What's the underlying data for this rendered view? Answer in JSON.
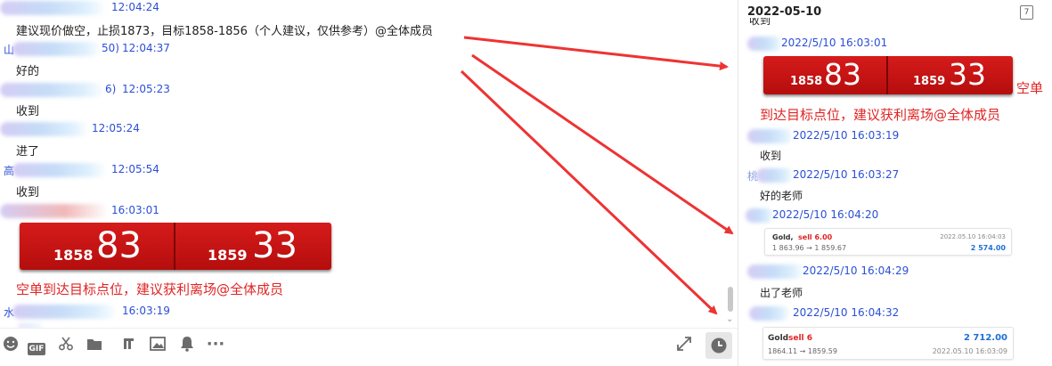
{
  "left_chat": {
    "messages": [
      {
        "time": "12:04:24",
        "text": "建议现价做空，止损1873，目标1858-1856（个人建议，仅供参考）@全体成员"
      },
      {
        "name_prefix": "山",
        "name_suffix": "50)",
        "time": "12:04:37",
        "text": "好的"
      },
      {
        "name_suffix": "6)",
        "time": "12:05:23",
        "text": "收到"
      },
      {
        "time": "12:05:24",
        "text": "进了"
      },
      {
        "name_prefix": "高",
        "time": "12:05:54",
        "text": "收到"
      },
      {
        "time": "16:03:01"
      },
      {
        "name_prefix": "水",
        "time": "16:03:19"
      }
    ],
    "quote": {
      "left_small": "1858",
      "left_big": "83",
      "right_small": "1859",
      "right_big": "33"
    },
    "caption": "空单到达目标点位，建议获利离场@全体成员"
  },
  "toolbar": {
    "emoji_icon": "smiley-icon",
    "gif_label": "GIF",
    "scissors_icon": "scissors-icon",
    "folder_icon": "folder-icon",
    "music_icon": "music-icon",
    "image_icon": "image-icon",
    "bell_icon": "bell-icon",
    "more_label": "···",
    "expand_icon": "expand-icon",
    "history_icon": "clock-icon"
  },
  "right_panel": {
    "date": "2022-05-10",
    "calendar_label": "7",
    "top_cut_text": "收到",
    "messages": [
      {
        "time": "2022/5/10 16:03:01"
      },
      {
        "time": "2022/5/10 16:03:19",
        "text": "收到"
      },
      {
        "name_prefix": "桃",
        "time": "2022/5/10 16:03:27",
        "text": "好的老师"
      },
      {
        "time": "2022/5/10 16:04:20"
      },
      {
        "time": "2022/5/10 16:04:29",
        "text": "出了老师"
      },
      {
        "time": "2022/5/10 16:04:32"
      }
    ],
    "quote": {
      "left_small": "1858",
      "left_big": "83",
      "right_small": "1859",
      "right_big": "33",
      "side_label": "空单"
    },
    "caption": "到达目标点位，建议获利离场@全体成员",
    "trade_card_1": {
      "symbol": "Gold,",
      "action": "sell 6.00",
      "date": "2022.05.10 16:04:03",
      "prices": "1 863.96 → 1 859.67",
      "profit": "2 574.00"
    },
    "trade_card_2": {
      "symbol": "Gold",
      "action": "sell 6",
      "profit": "2 712.00",
      "prices": "1864.11 → 1859.59",
      "date": "2022.05.10 16:03:09"
    }
  },
  "colors": {
    "timestamp": "#2a4fd6",
    "alert_red": "#e02424",
    "quote_red": "#c81414",
    "arrow_red": "#ee3333",
    "profit_blue": "#1f6fd6"
  }
}
